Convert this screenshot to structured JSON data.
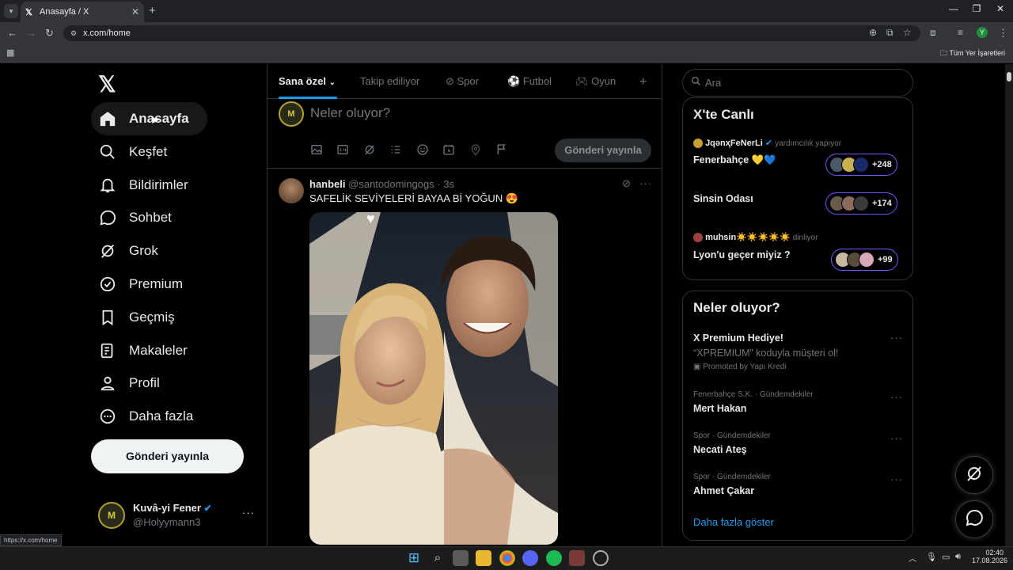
{
  "browser": {
    "tab_title": "Anasayfa / X",
    "url": "x.com/home",
    "bookmarks_label": "Tüm Yer İşaretleri",
    "status_url": "https://x.com/home",
    "profile_initial": "Y"
  },
  "sidebar": {
    "items": [
      {
        "label": "Anasayfa",
        "icon": "home-icon"
      },
      {
        "label": "Keşfet",
        "icon": "search-icon"
      },
      {
        "label": "Bildirimler",
        "icon": "bell-icon"
      },
      {
        "label": "Sohbet",
        "icon": "chat-icon"
      },
      {
        "label": "Grok",
        "icon": "grok-icon"
      },
      {
        "label": "Premium",
        "icon": "verified-icon"
      },
      {
        "label": "Geçmiş",
        "icon": "bookmark-icon"
      },
      {
        "label": "Makaleler",
        "icon": "article-icon"
      },
      {
        "label": "Profil",
        "icon": "person-icon"
      },
      {
        "label": "Daha fazla",
        "icon": "more-circle-icon"
      }
    ],
    "post_button": "Gönderi yayınla",
    "account": {
      "name": "Kuvâ-yi Fener",
      "handle": "@Holyymann3"
    }
  },
  "feed": {
    "tabs": [
      "Sana özel",
      "Takip ediliyor",
      "Spor",
      "Futbol",
      "Oyun"
    ],
    "compose_placeholder": "Neler oluyor?",
    "compose_button": "Gönderi yayınla",
    "tweet": {
      "name": "hanbeli",
      "handle": "@santodomingogs",
      "time": "· 3s",
      "text": "SAFELİK SEVİYELERİ BAYAA Bİ YOĞUN 😍"
    }
  },
  "right": {
    "search_placeholder": "Ara",
    "live": {
      "title": "X'te Canlı",
      "spaces": [
        {
          "host": "JqǝnҳFeNerLi",
          "host_note": "yardımcılık yapıyor",
          "title": "Fenerbahçe 💛💙",
          "count": "+248"
        },
        {
          "host": "",
          "host_note": "",
          "title": "Sinsin Odası",
          "count": "+174"
        },
        {
          "host": "muhsin☀️☀️☀️☀️☀️",
          "host_note": "dinliyor",
          "title": "Lyon'u geçer miyiz ?",
          "count": "+99"
        }
      ]
    },
    "trends": {
      "title": "Neler oluyor?",
      "promo": {
        "title": "X Premium Hediye!",
        "text": "“XPREMIUM” koduyla müşteri ol!",
        "promoted": "Promoted by Yapı Kredi"
      },
      "items": [
        {
          "context": "Fenerbahçe S.K. · Gündemdekiler",
          "title": "Mert Hakan"
        },
        {
          "context": "Spor · Gündemdekiler",
          "title": "Necati Ateş"
        },
        {
          "context": "Spor · Gündemdekiler",
          "title": "Ahmet Çakar"
        }
      ],
      "show_more": "Daha fazla göster"
    }
  },
  "taskbar": {
    "time": "02:40",
    "date": "17.08.2026"
  },
  "colors": {
    "accent": "#1d9bf0",
    "background": "#000000",
    "live_border": "#7856ff"
  }
}
